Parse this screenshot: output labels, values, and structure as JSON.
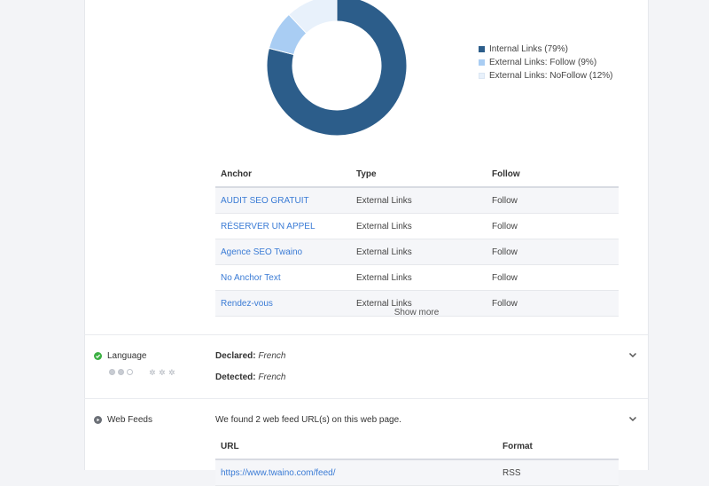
{
  "links_chart": {
    "colors": {
      "internal": "#2c5d8a",
      "external_follow": "#a9cdf3",
      "external_nofollow": "#e8f1fb"
    },
    "legend": [
      {
        "label": "Internal Links (79%)",
        "color": "#2c5d8a"
      },
      {
        "label": "External Links: Follow (9%)",
        "color": "#a9cdf3"
      },
      {
        "label": "External Links: NoFollow (12%)",
        "color": "#e8f1fb"
      }
    ]
  },
  "chart_data": {
    "type": "pie",
    "categories": [
      "Internal Links",
      "External Links: Follow",
      "External Links: NoFollow"
    ],
    "values": [
      79,
      9,
      12
    ],
    "title": "",
    "donut": true
  },
  "links_table": {
    "headers": [
      "Anchor",
      "Type",
      "Follow"
    ],
    "rows": [
      [
        "AUDIT SEO GRATUIT",
        "External Links",
        "Follow"
      ],
      [
        "RÉSERVER UN APPEL",
        "External Links",
        "Follow"
      ],
      [
        "Agence SEO Twaino",
        "External Links",
        "Follow"
      ],
      [
        "No Anchor Text",
        "External Links",
        "Follow"
      ],
      [
        "Rendez-vous",
        "External Links",
        "Follow"
      ]
    ],
    "show_more": "Show more"
  },
  "language": {
    "label": "Language",
    "declared_label": "Declared:",
    "declared_value": "French",
    "detected_label": "Detected:",
    "detected_value": "French",
    "status_color": "#3cb043"
  },
  "web_feeds": {
    "label": "Web Feeds",
    "summary": "We found 2 web feed URL(s) on this web page.",
    "headers": [
      "URL",
      "Format"
    ],
    "rows": [
      [
        "https://www.twaino.com/feed/",
        "RSS"
      ]
    ]
  },
  "icons": {
    "language_status": "check-circle-icon",
    "web_feeds_status": "play-circle-icon",
    "expand": "chevron-down-icon"
  }
}
